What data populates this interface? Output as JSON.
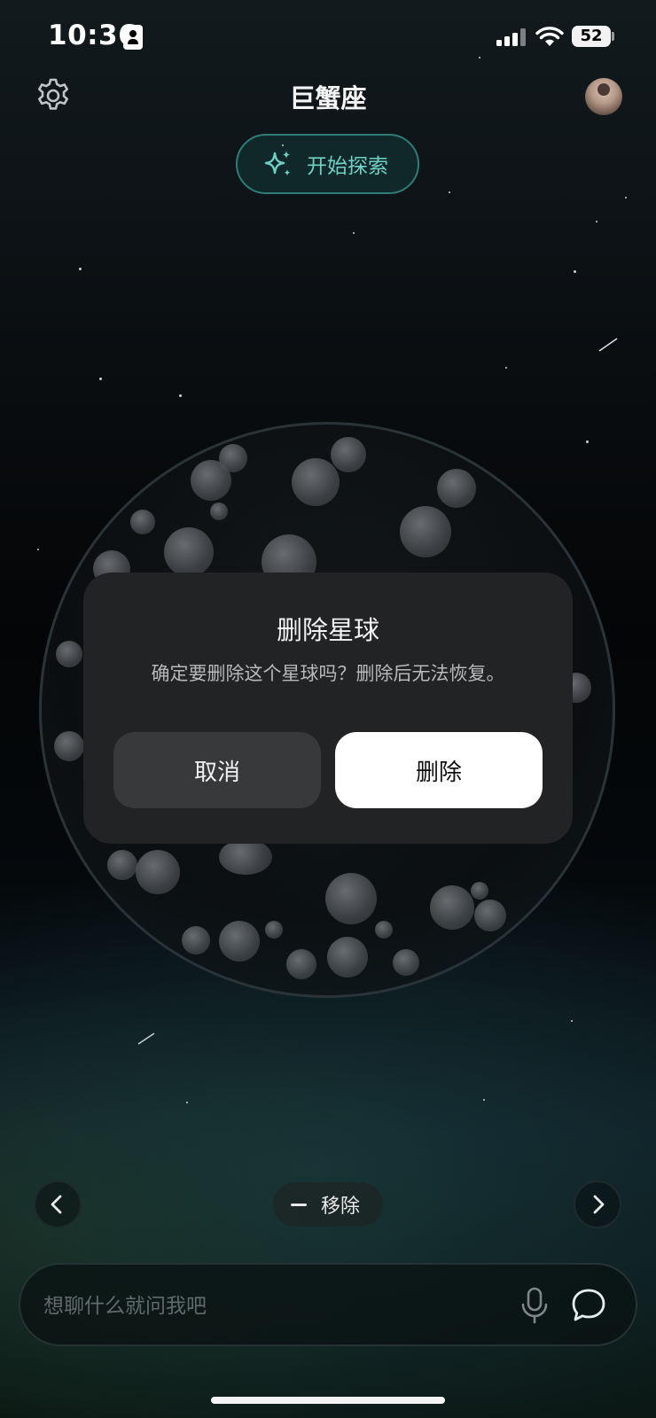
{
  "status_bar": {
    "time": "10:36",
    "battery": "52",
    "icons": [
      "id-card-icon",
      "cellular-signal-icon",
      "wifi-icon",
      "battery-icon"
    ]
  },
  "header": {
    "title": "巨蟹座",
    "settings_icon": "gear-icon",
    "avatar": "user-avatar"
  },
  "explore_button": {
    "label": "开始探索",
    "icon": "sparkles-icon",
    "accent_color": "#6fd1c6"
  },
  "dialog": {
    "title": "删除星球",
    "message": "确定要删除这个星球吗？删除后无法恢复。",
    "cancel_label": "取消",
    "confirm_label": "删除"
  },
  "bottom_nav": {
    "prev_icon": "chevron-left-icon",
    "next_icon": "chevron-right-icon",
    "remove_label": "移除",
    "remove_icon": "minus-icon"
  },
  "chat": {
    "placeholder": "想聊什么就问我吧",
    "value": "",
    "mic_icon": "microphone-icon",
    "chat_icon": "chat-bubble-icon"
  }
}
